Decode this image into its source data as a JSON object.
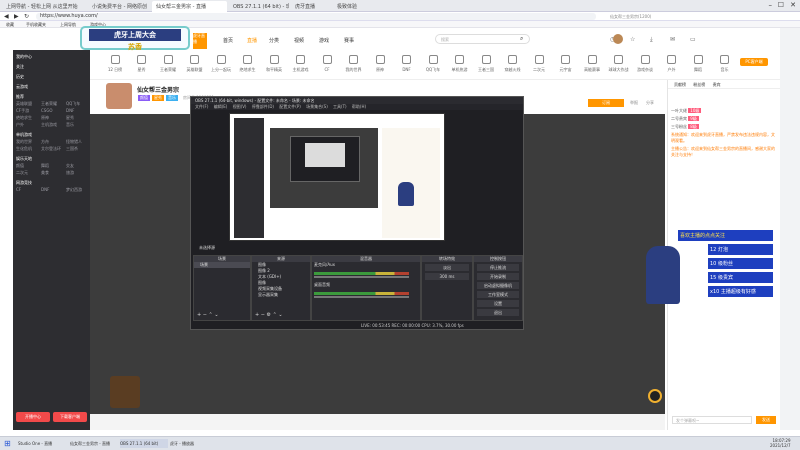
{
  "tabs": [
    "上网导航 - 轻松上网 从这里开始",
    "小说免费平台 - 网络原创",
    "仙女帮三金男宗 - 直播",
    "OBS 27.1.1 (64 bit) - 现场直播",
    "虎牙直播",
    "极致体验"
  ],
  "address": "https://www.huya.com/",
  "address_hint": "仙女帮三金男宗(1200)",
  "bookmarks": [
    "收藏",
    "手机收藏夹",
    "上网导航",
    "游戏中心"
  ],
  "site": {
    "logo": "虎牙直播",
    "banner_text": "虎牙上周大会",
    "banner_sub": "苏香",
    "nav": [
      "首页",
      "直播",
      "分类",
      "视频",
      "游戏",
      "赛事"
    ],
    "search_placeholder": "搜索"
  },
  "categories": [
    "12 日榜",
    "星秀",
    "王者荣耀",
    "英雄联盟",
    "上分一起玩",
    "绝地求生",
    "和平精英",
    "主机游戏",
    "CF",
    "我的世界",
    "原神",
    "DNF",
    "QQ飞车",
    "单机热游",
    "王者三国",
    "穿越火线",
    "二次元",
    "元宇宙",
    "高能赛事",
    "球球大作战",
    "游戏杂谈",
    "户外",
    "舞蹈",
    "音乐",
    "PC客户端"
  ],
  "sidebar": {
    "sections": [
      {
        "title": "我的中心",
        "items": []
      },
      {
        "title": "关注",
        "items": []
      },
      {
        "title": "历史",
        "items": []
      },
      {
        "title": "云游戏",
        "items": []
      },
      {
        "title": "推荐",
        "items": [
          "英雄联盟",
          "王者荣耀",
          "QQ飞车",
          "CF手游",
          "CSGO",
          "DNF",
          "绝地求生",
          "原神",
          "星秀",
          "户外",
          "主机游戏",
          "音乐"
        ]
      },
      {
        "title": "单机游戏",
        "items": [
          "我的世界",
          "方舟",
          "怪物猎人",
          "生化危机",
          "艾尔登法环",
          "三国杀"
        ]
      },
      {
        "title": "娱乐天地",
        "items": [
          "颜值",
          "舞蹈",
          "交友",
          "二次元",
          "美食",
          "旅游"
        ]
      },
      {
        "title": "网游竞技",
        "items": [
          "CF",
          "DNF",
          "梦幻西游"
        ]
      }
    ],
    "btn_left": "开播中心",
    "btn_right": "下载客户端"
  },
  "room": {
    "name": "仙女帮三金男宗",
    "tags": [
      "颜值",
      "星秀",
      "音乐"
    ],
    "room_id": "房间号 1100331",
    "subscribe": "订阅",
    "report": "举报",
    "share": "分享"
  },
  "obs": {
    "title": "OBS 27.1.1 (64-bit, windows) - 配置文件: 未命名 - 场景: 未命名",
    "menu": [
      "文件(F)",
      "编辑(E)",
      "视图(V)",
      "停靠部件(D)",
      "配置文件(P)",
      "场景集合(S)",
      "工具(T)",
      "帮助(H)"
    ],
    "docks": [
      "场景",
      "来源",
      "混音器",
      "转场特效",
      "控制按钮"
    ],
    "scene": "场景",
    "sources": [
      "图像",
      "图像 2",
      "文本 (GDI+)",
      "图像",
      "视频采集设备",
      "显示器采集"
    ],
    "mixer": [
      "麦克风/Aux",
      "桌面音频"
    ],
    "transition": "淡出",
    "duration": "300 ms",
    "controls": [
      "停止推流",
      "开始录制",
      "启动虚拟摄像机",
      "工作室模式",
      "设置",
      "退出"
    ],
    "status": "LIVE: 00:53:45  REC: 00:00:00  CPU: 3.7%, 30.00 fps",
    "no_source": "未选择源"
  },
  "chat": {
    "tabs": [
      "贡献榜",
      "粉丝榜",
      "贵宾"
    ],
    "rank": [
      {
        "name": "一叶大佬",
        "badge": "10级"
      },
      {
        "name": "二号贵宾",
        "badge": "9级"
      },
      {
        "name": "三号粉丝",
        "badge": "8级"
      }
    ],
    "notice": "系统通知：欢迎来到虎牙直播，严禁发布违法违规内容，文明观看。",
    "announce": "主播公告：欢迎来到仙女帮三金男宗的直播间，感谢大家的关注与支持！",
    "gifts": [
      {
        "text": "喜欢主播的点点关注",
        "count": ""
      },
      {
        "text": "12 灯泡",
        "count": "12"
      },
      {
        "text": "10 级粉丝",
        "count": "10"
      },
      {
        "text": "15 级贵宾",
        "count": "15"
      },
      {
        "text": "x10 主播超级有好感",
        "count": "10"
      }
    ],
    "input_placeholder": "发个弹幕呗~",
    "send": "发送"
  },
  "taskbar": {
    "apps": [
      "Studio One - 直播",
      "仙女帮三金男宗 - 直播",
      "OBS 27.1.1 (64 bit)",
      "虎牙 - 播放器"
    ],
    "time": "18:07:29",
    "date": "2021/12/7"
  },
  "colors": {
    "accent": "#ff9600",
    "chat_accent": "#ff5c7c",
    "obs_bg": "#1f1f23",
    "player_bg": "#3c3c3c",
    "sidebar_bg": "#2d2d31"
  }
}
